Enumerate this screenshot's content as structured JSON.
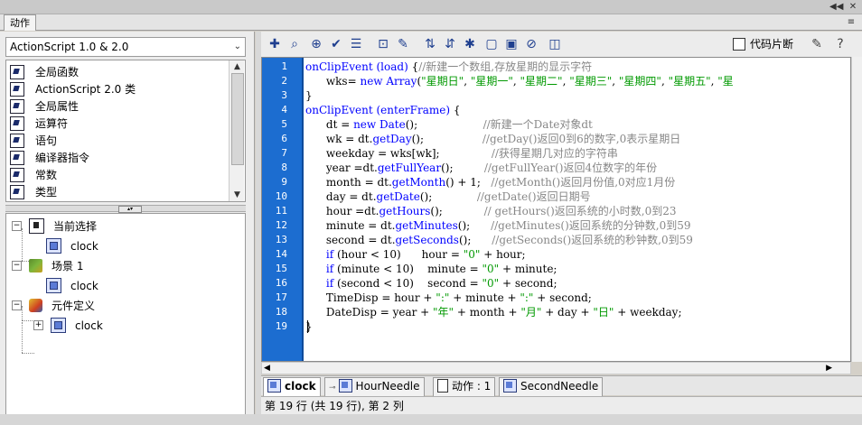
{
  "panel": {
    "tab_label": "动作"
  },
  "left": {
    "version_select": "ActionScript 1.0 & 2.0",
    "toolbox_items": [
      "全局函数",
      "ActionScript 2.0 类",
      "全局属性",
      "运算符",
      "语句",
      "编译器指令",
      "常数",
      "类型"
    ],
    "tree": [
      {
        "label": "当前选择",
        "icon": "selection-icon",
        "expanded": true
      },
      {
        "label": "clock",
        "icon": "movieclip-icon"
      },
      {
        "label": "场景 1",
        "icon": "scene-icon",
        "expanded": true
      },
      {
        "label": "clock",
        "icon": "movieclip-icon"
      },
      {
        "label": "元件定义",
        "icon": "symbol-definitions-icon",
        "expanded": true
      },
      {
        "label": "clock",
        "icon": "movieclip-icon",
        "collapsed": true
      }
    ]
  },
  "toolbar": {
    "icons": [
      "add-script-icon",
      "find-icon",
      "insert-target-path-icon",
      "check-syntax-icon",
      "auto-format-icon",
      "show-code-hint-icon",
      "debug-options-icon",
      "collapse-between-braces-icon",
      "collapse-selection-icon",
      "expand-all-icon",
      "apply-block-comment-icon",
      "apply-line-comment-icon",
      "remove-comment-icon",
      "show-hide-toolbox-icon"
    ],
    "code_snippets_label": "代码片断"
  },
  "code": {
    "line_numbers": [
      "1",
      "2",
      "3",
      "4",
      "5",
      "6",
      "7",
      "8",
      "9",
      "10",
      "11",
      "12",
      "13",
      "14",
      "15",
      "16",
      "17",
      "18",
      "19"
    ],
    "lines": [
      [
        {
          "t": "onClipEvent (load) ",
          "c": "kw"
        },
        {
          "t": "{",
          "c": ""
        },
        {
          "t": "//新建一个数组,存放星期的显示字符",
          "c": "cm"
        }
      ],
      [
        {
          "t": "      wks= ",
          "c": ""
        },
        {
          "t": "new Array",
          "c": "kw"
        },
        {
          "t": "(",
          "c": ""
        },
        {
          "t": "\"星期日\"",
          "c": "st"
        },
        {
          "t": ", ",
          "c": ""
        },
        {
          "t": "\"星期一\"",
          "c": "st"
        },
        {
          "t": ", ",
          "c": ""
        },
        {
          "t": "\"星期二\"",
          "c": "st"
        },
        {
          "t": ", ",
          "c": ""
        },
        {
          "t": "\"星期三\"",
          "c": "st"
        },
        {
          "t": ", ",
          "c": ""
        },
        {
          "t": "\"星期四\"",
          "c": "st"
        },
        {
          "t": ", ",
          "c": ""
        },
        {
          "t": "\"星期五\"",
          "c": "st"
        },
        {
          "t": ", ",
          "c": ""
        },
        {
          "t": "\"星",
          "c": "st"
        }
      ],
      [
        {
          "t": "}",
          "c": ""
        }
      ],
      [
        {
          "t": "onClipEvent (enterFrame) ",
          "c": "kw"
        },
        {
          "t": "{",
          "c": ""
        }
      ],
      [
        {
          "t": "      dt = ",
          "c": ""
        },
        {
          "t": "new Date",
          "c": "kw"
        },
        {
          "t": "();                   ",
          "c": ""
        },
        {
          "t": "//新建一个Date对象dt",
          "c": "cm"
        }
      ],
      [
        {
          "t": "      wk = dt.",
          "c": ""
        },
        {
          "t": "getDay",
          "c": "kw"
        },
        {
          "t": "();                 ",
          "c": ""
        },
        {
          "t": "//getDay()返回0到6的数字,0表示星期日",
          "c": "cm"
        }
      ],
      [
        {
          "t": "      weekday = wks[wk];               ",
          "c": ""
        },
        {
          "t": "//获得星期几对应的字符串",
          "c": "cm"
        }
      ],
      [
        {
          "t": "      year =dt.",
          "c": ""
        },
        {
          "t": "getFullYear",
          "c": "kw"
        },
        {
          "t": "();         ",
          "c": ""
        },
        {
          "t": "//getFullYear()返回4位数字的年份",
          "c": "cm"
        }
      ],
      [
        {
          "t": "      month = dt.",
          "c": ""
        },
        {
          "t": "getMonth",
          "c": "kw"
        },
        {
          "t": "() + 1;   ",
          "c": ""
        },
        {
          "t": "//getMonth()返回月份值,0对应1月份",
          "c": "cm"
        }
      ],
      [
        {
          "t": "      day = dt.",
          "c": ""
        },
        {
          "t": "getDate",
          "c": "kw"
        },
        {
          "t": "();             ",
          "c": ""
        },
        {
          "t": "//getDate()返回日期号",
          "c": "cm"
        }
      ],
      [
        {
          "t": "      hour =dt.",
          "c": ""
        },
        {
          "t": "getHours",
          "c": "kw"
        },
        {
          "t": "();            ",
          "c": ""
        },
        {
          "t": "// getHours()返回系统的小时数,0到23",
          "c": "cm"
        }
      ],
      [
        {
          "t": "      minute = dt.",
          "c": ""
        },
        {
          "t": "getMinutes",
          "c": "kw"
        },
        {
          "t": "();      ",
          "c": ""
        },
        {
          "t": "//getMinutes()返回系统的分钟数,0到59",
          "c": "cm"
        }
      ],
      [
        {
          "t": "      second = dt.",
          "c": ""
        },
        {
          "t": "getSeconds",
          "c": "kw"
        },
        {
          "t": "();      ",
          "c": ""
        },
        {
          "t": "//getSeconds()返回系统的秒钟数,0到59",
          "c": "cm"
        }
      ],
      [
        {
          "t": "      ",
          "c": ""
        },
        {
          "t": "if",
          "c": "kw"
        },
        {
          "t": " (hour < 10)      hour = ",
          "c": ""
        },
        {
          "t": "\"0\"",
          "c": "st"
        },
        {
          "t": " + hour;",
          "c": ""
        }
      ],
      [
        {
          "t": "      ",
          "c": ""
        },
        {
          "t": "if",
          "c": "kw"
        },
        {
          "t": " (minute < 10)    minute = ",
          "c": ""
        },
        {
          "t": "\"0\"",
          "c": "st"
        },
        {
          "t": " + minute;",
          "c": ""
        }
      ],
      [
        {
          "t": "      ",
          "c": ""
        },
        {
          "t": "if",
          "c": "kw"
        },
        {
          "t": " (second < 10)    second = ",
          "c": ""
        },
        {
          "t": "\"0\"",
          "c": "st"
        },
        {
          "t": " + second;",
          "c": ""
        }
      ],
      [
        {
          "t": "      TimeDisp = hour + ",
          "c": ""
        },
        {
          "t": "\":\"",
          "c": "st"
        },
        {
          "t": " + minute + ",
          "c": ""
        },
        {
          "t": "\":\"",
          "c": "st"
        },
        {
          "t": " + second;",
          "c": ""
        }
      ],
      [
        {
          "t": "      DateDisp = year + ",
          "c": ""
        },
        {
          "t": "\"年\"",
          "c": "st"
        },
        {
          "t": " + month + ",
          "c": ""
        },
        {
          "t": "\"月\"",
          "c": "st"
        },
        {
          "t": " + day + ",
          "c": ""
        },
        {
          "t": "\"日\"",
          "c": "st"
        },
        {
          "t": " + weekday;",
          "c": ""
        }
      ],
      [
        {
          "t": "}",
          "c": ""
        }
      ]
    ]
  },
  "tabs": [
    {
      "label": "clock",
      "active": true
    },
    {
      "label": "HourNeedle",
      "active": false
    },
    {
      "label": "动作 : 1",
      "active": false
    },
    {
      "label": "SecondNeedle",
      "active": false
    }
  ],
  "status": "第 19 行 (共 19 行), 第 2 列",
  "colors": {
    "gutter": "#1c6dd0",
    "keyword": "#0000ff",
    "string": "#009900",
    "comment": "#878787"
  }
}
